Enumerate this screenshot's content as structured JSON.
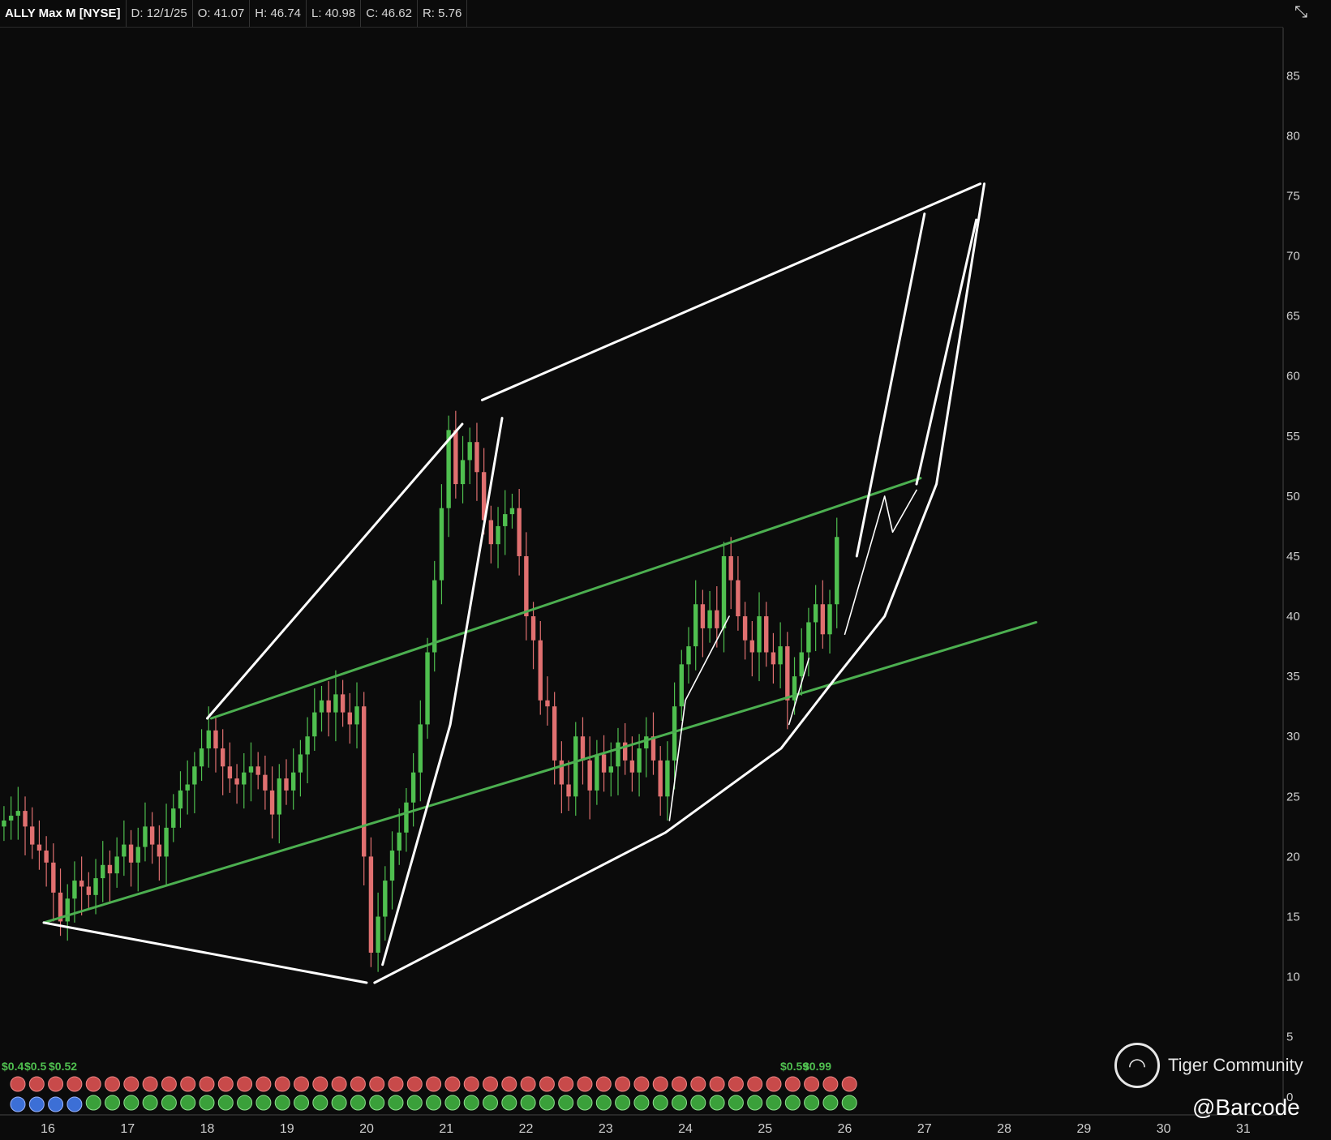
{
  "header": {
    "symbol": "ALLY Max M [NYSE]",
    "date": "D: 12/1/25",
    "open": "O: 41.07",
    "high": "H: 46.74",
    "low": "L: 40.98",
    "close": "C: 46.62",
    "range": "R: 5.76",
    "tool_icon": "crosshair-tool-icon"
  },
  "watermark": {
    "brand": "Tiger Community",
    "handle": "@Barcode"
  },
  "dividend_labels": [
    "$0.4",
    "$0.5",
    "$0.52",
    "$0.59",
    "$0.99"
  ],
  "colors": {
    "background": "#0b0b0b",
    "up": "#4fbf4f",
    "down": "#e07070",
    "channel": "#4caf50",
    "drawing": "#ffffff",
    "axis_text": "#cfcfcf"
  },
  "chart_data": {
    "type": "candlestick",
    "title": "ALLY Max M [NYSE]",
    "xlabel": "",
    "ylabel": "",
    "x_ticks": [
      "16",
      "17",
      "18",
      "19",
      "20",
      "21",
      "22",
      "23",
      "24",
      "25",
      "26",
      "27",
      "28",
      "29",
      "30",
      "31"
    ],
    "y_ticks": [
      0,
      5,
      10,
      15,
      20,
      25,
      30,
      35,
      40,
      45,
      50,
      55,
      60,
      65,
      70,
      75,
      80,
      85
    ],
    "xlim": [
      15.4,
      31.5
    ],
    "ylim": [
      -1.5,
      89
    ],
    "grid": false,
    "closes": [
      23.0,
      23.4,
      23.8,
      22.5,
      21.0,
      20.5,
      19.5,
      17.0,
      14.6,
      16.5,
      18.0,
      17.5,
      16.8,
      18.2,
      19.3,
      18.6,
      20.0,
      21.0,
      19.5,
      20.8,
      22.5,
      21.0,
      20.0,
      22.4,
      24.0,
      25.5,
      26.0,
      27.5,
      29.0,
      30.5,
      29.0,
      27.5,
      26.5,
      26.0,
      27.0,
      27.5,
      26.8,
      25.5,
      23.5,
      26.5,
      25.5,
      27.0,
      28.5,
      30.0,
      32.0,
      33.0,
      32.0,
      33.5,
      32.0,
      31.0,
      32.5,
      20.0,
      12.0,
      15.0,
      18.0,
      20.5,
      22.0,
      24.5,
      27.0,
      31.0,
      37.0,
      43.0,
      49.0,
      55.5,
      51.0,
      53.0,
      54.5,
      52.0,
      48.0,
      46.0,
      47.5,
      48.5,
      49.0,
      45.0,
      40.0,
      38.0,
      33.0,
      32.5,
      28.0,
      26.0,
      25.0,
      30.0,
      28.0,
      25.5,
      28.5,
      27.0,
      27.5,
      29.5,
      28.0,
      27.0,
      29.0,
      30.0,
      28.0,
      25.0,
      28.0,
      32.5,
      36.0,
      37.5,
      41.0,
      39.0,
      40.5,
      39.0,
      45.0,
      43.0,
      40.0,
      38.0,
      37.0,
      40.0,
      37.0,
      36.0,
      37.5,
      33.0,
      35.0,
      37.0,
      39.5,
      41.0,
      38.5,
      41.0,
      46.6
    ],
    "series": [
      {
        "name": "upper channel",
        "points": [
          [
            18.05,
            31.5
          ],
          [
            26.95,
            51.5
          ]
        ]
      },
      {
        "name": "lower channel",
        "points": [
          [
            15.95,
            14.5
          ],
          [
            28.4,
            39.5
          ]
        ]
      },
      {
        "name": "projection upper",
        "points": [
          [
            18.0,
            31.5
          ],
          [
            21.2,
            56.0
          ]
        ]
      },
      {
        "name": "projection top",
        "points": [
          [
            21.45,
            58.0
          ],
          [
            27.7,
            76.0
          ]
        ]
      },
      {
        "name": "projection base",
        "points": [
          [
            15.95,
            14.5
          ],
          [
            20.0,
            9.5
          ]
        ]
      },
      {
        "name": "projection lower",
        "points": [
          [
            20.1,
            9.5
          ],
          [
            23.75,
            22.0
          ],
          [
            25.2,
            29.0
          ],
          [
            25.9,
            35.0
          ],
          [
            26.5,
            40.0
          ],
          [
            27.15,
            51.0
          ],
          [
            27.75,
            76.0
          ]
        ]
      },
      {
        "name": "impulse",
        "points": [
          [
            20.2,
            11.0
          ],
          [
            21.05,
            31.0
          ],
          [
            21.7,
            56.5
          ]
        ]
      },
      {
        "name": "projection line a",
        "points": [
          [
            26.15,
            45.0
          ],
          [
            27.0,
            73.5
          ]
        ]
      },
      {
        "name": "projection line b",
        "points": [
          [
            26.9,
            51.0
          ],
          [
            27.65,
            73.0
          ]
        ]
      },
      {
        "name": "zigzag",
        "points": [
          [
            26.0,
            38.5
          ],
          [
            26.5,
            50.0
          ],
          [
            26.6,
            47.0
          ],
          [
            26.9,
            50.5
          ]
        ]
      },
      {
        "name": "wave minor 1",
        "points": [
          [
            23.8,
            23.0
          ],
          [
            24.0,
            33.0
          ],
          [
            24.55,
            40.0
          ]
        ]
      },
      {
        "name": "wave minor 2",
        "points": [
          [
            25.3,
            31.0
          ],
          [
            25.55,
            36.5
          ]
        ]
      }
    ]
  }
}
